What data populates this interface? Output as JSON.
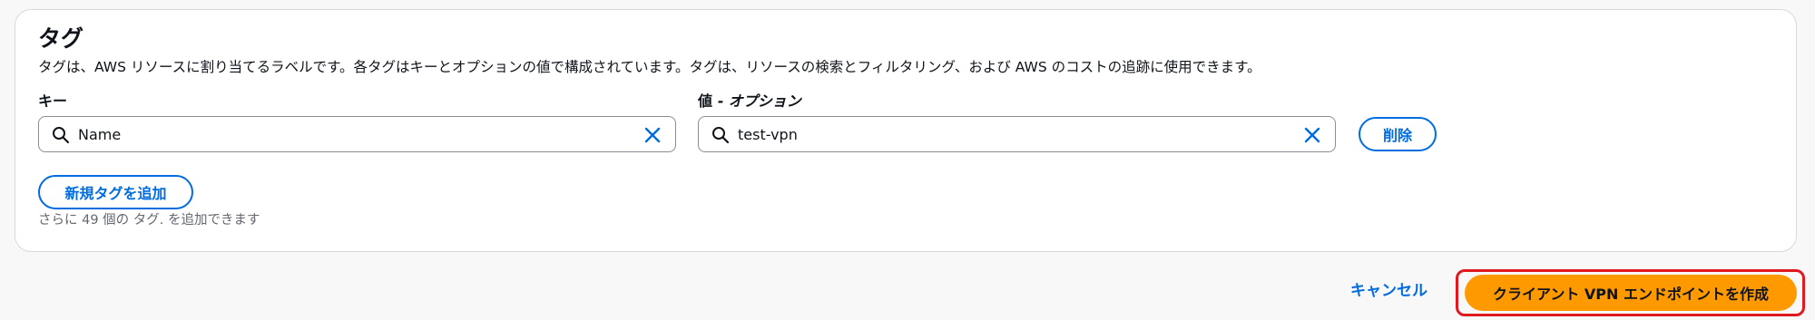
{
  "tags_section": {
    "title": "タグ",
    "description": "タグは、AWS リソースに割り当てるラベルです。各タグはキーとオプションの値で構成されています。タグは、リソースの検索とフィルタリング、および AWS のコストの追跡に使用できます。",
    "key_label": "キー",
    "value_label_prefix": "値 - ",
    "value_label_optional": "オプション",
    "rows": [
      {
        "key": "Name",
        "value": "test-vpn",
        "remove_label": "削除"
      }
    ],
    "add_tag_label": "新規タグを追加",
    "remaining_hint": "さらに 49 個の タグ. を追加できます"
  },
  "footer": {
    "cancel_label": "キャンセル",
    "create_label": "クライアント VPN エンドポイントを作成"
  },
  "colors": {
    "accent": "#006ce0",
    "primary_button": "#ff9900",
    "highlight": "#e0191f",
    "border": "#8c8c94"
  },
  "icons": {
    "search": "search-icon",
    "clear": "close-icon"
  }
}
